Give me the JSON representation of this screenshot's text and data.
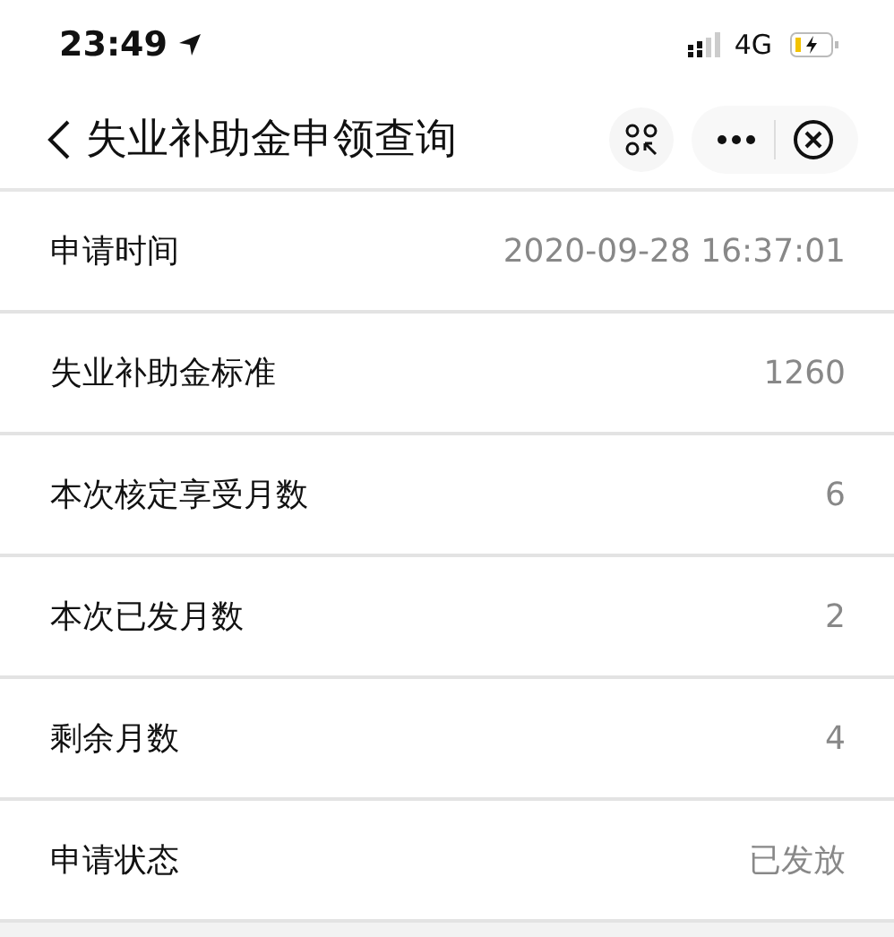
{
  "status_bar": {
    "time": "23:49",
    "network": "4G"
  },
  "nav_bar": {
    "title": "失业补助金申领查询"
  },
  "rows": [
    {
      "label": "申请时间",
      "value": "2020-09-28 16:37:01"
    },
    {
      "label": "失业补助金标准",
      "value": "1260"
    },
    {
      "label": "本次核定享受月数",
      "value": "6"
    },
    {
      "label": "本次已发月数",
      "value": "2"
    },
    {
      "label": "剩余月数",
      "value": "4"
    },
    {
      "label": "申请状态",
      "value": "已发放"
    }
  ]
}
